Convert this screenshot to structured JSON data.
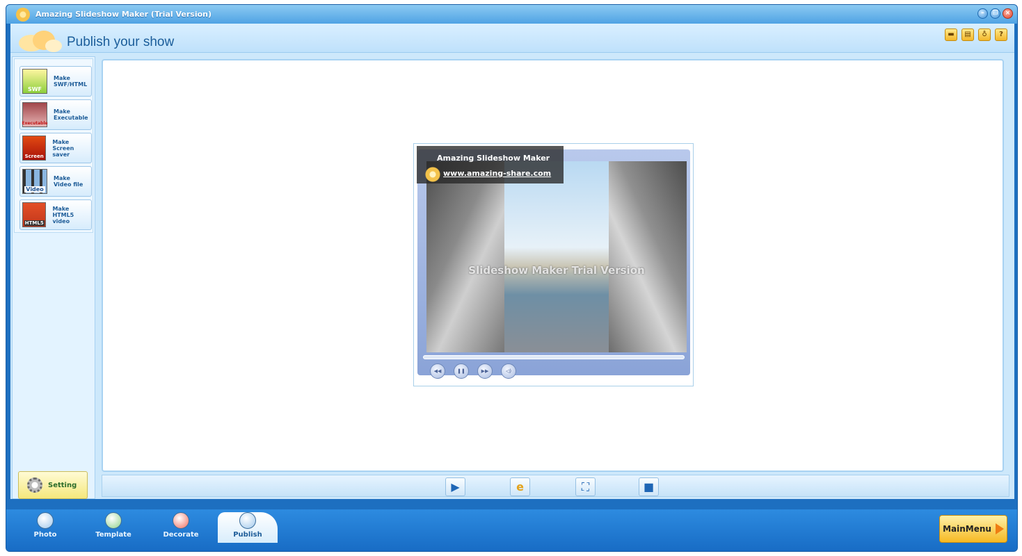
{
  "window": {
    "title": "Amazing Slideshow Maker (Trial Version)",
    "controls": [
      "minimize-icon",
      "restore-icon",
      "close-icon"
    ]
  },
  "header": {
    "title": "Publish your show",
    "icons": [
      "folder-icon",
      "save-icon",
      "lightbulb-icon",
      "help-icon"
    ]
  },
  "sidebar": {
    "items": [
      {
        "icon_text": "SWF",
        "line1": "Make",
        "line2": "SWF/HTML",
        "icon": "swf-icon"
      },
      {
        "icon_text": "Executable",
        "line1": "Make",
        "line2": "Executable",
        "icon": "executable-icon"
      },
      {
        "icon_text": "Screen",
        "line1": "Make",
        "line2": "Screen saver",
        "icon": "screensaver-icon"
      },
      {
        "icon_text": "Video",
        "line1": "Make",
        "line2": "Video file",
        "icon": "video-icon"
      },
      {
        "icon_text": "HTML5",
        "line1": "Make",
        "line2": "HTML5 video",
        "icon": "html5-icon"
      }
    ],
    "setting_label": "Setting"
  },
  "preview": {
    "brand_title": "Amazing Slideshow Maker",
    "brand_url": "www.amazing-share.com",
    "watermark": "Slideshow Maker Trial Version",
    "player_controls": [
      "rewind-icon",
      "pause-icon",
      "fast-forward-icon",
      "volume-icon"
    ]
  },
  "control_bar": {
    "buttons": [
      "play-icon",
      "browser-icon",
      "fullscreen-icon",
      "stop-icon"
    ]
  },
  "bottom_tabs": {
    "tabs": [
      {
        "label": "Photo",
        "icon": "photo-icon"
      },
      {
        "label": "Template",
        "icon": "template-icon"
      },
      {
        "label": "Decorate",
        "icon": "decorate-icon"
      },
      {
        "label": "Publish",
        "icon": "publish-icon",
        "active": true
      }
    ],
    "main_menu_label": "MainMenu"
  },
  "colors": {
    "title_bar": "#4fa3e4",
    "accent_blue": "#1d6fc0",
    "header_text": "#1b5d9a",
    "setting_button": "#f5e87c",
    "main_menu_button": "#f6b923"
  }
}
